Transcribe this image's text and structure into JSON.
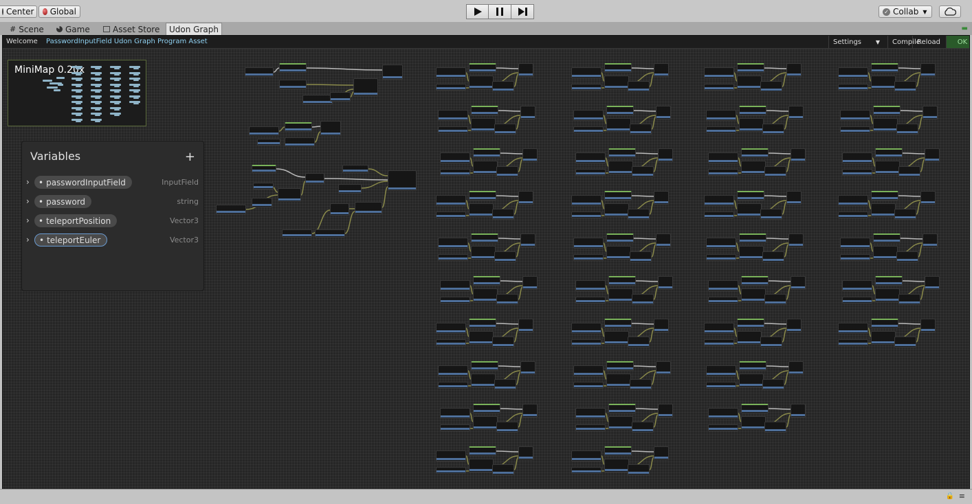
{
  "toolbar": {
    "pivot_label": "Center",
    "space_label": "Global",
    "collab_label": "Collab"
  },
  "tabs": [
    {
      "label": "Scene",
      "icon": "grid-icon"
    },
    {
      "label": "Game",
      "icon": "pacman-icon"
    },
    {
      "label": "Asset Store",
      "icon": "store-icon"
    },
    {
      "label": "Udon Graph",
      "active": true
    }
  ],
  "graph_header": {
    "welcome": "Welcome",
    "asset_name": "PasswordInputField Udon Graph Program Asset",
    "settings": "Settings",
    "compile": "Compile",
    "reload": "Reload",
    "status": "OK"
  },
  "minimap": {
    "title": "MiniMap",
    "zoom": "0.20x"
  },
  "variables": {
    "title": "Variables",
    "add_label": "+",
    "items": [
      {
        "name": "passwordInputField",
        "type": "InputField"
      },
      {
        "name": "password",
        "type": "string"
      },
      {
        "name": "teleportPosition",
        "type": "Vector3"
      },
      {
        "name": "teleportEuler",
        "type": "Vector3"
      }
    ]
  },
  "colors": {
    "graph_bg": "#262626",
    "event_header": "#7ab35a",
    "port_bar": "#4e6f9a",
    "wire": "#8a8a4a",
    "ok_green": "#2a5a2a"
  }
}
